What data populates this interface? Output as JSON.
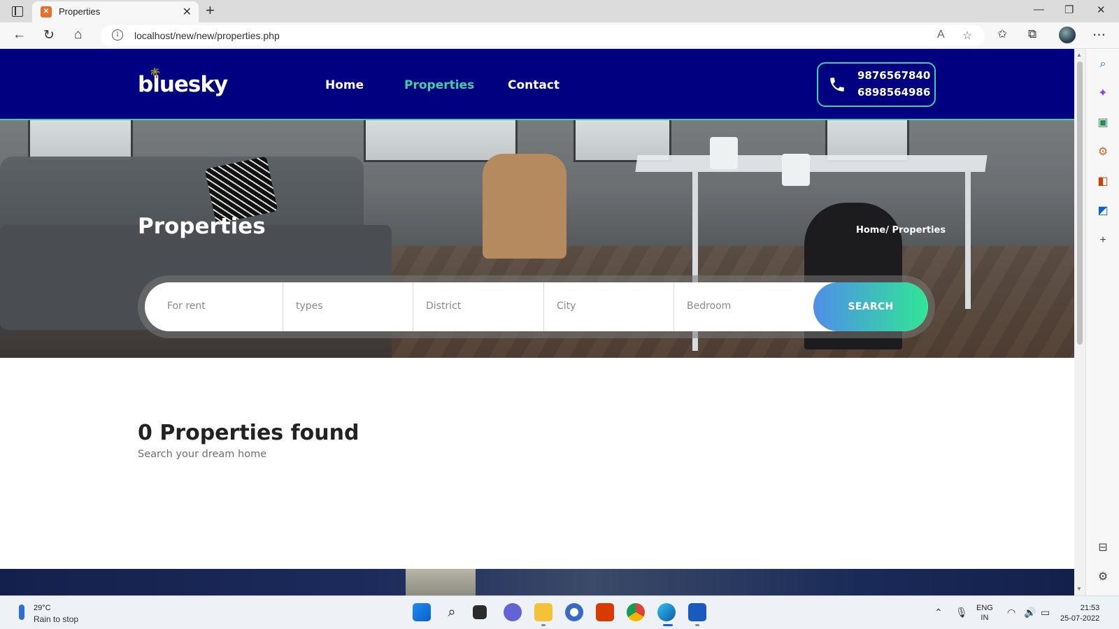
{
  "browser": {
    "tab_title": "Properties",
    "url": "localhost/new/new/properties.php"
  },
  "site": {
    "logo": "bluesky",
    "nav": [
      {
        "label": "Home",
        "active": false
      },
      {
        "label": "Properties",
        "active": true
      },
      {
        "label": "Contact",
        "active": false
      }
    ],
    "phones": [
      "9876567840",
      "6898564986"
    ],
    "accent_color": "#3ad2a0",
    "header_color": "#000080"
  },
  "hero": {
    "title": "Properties",
    "breadcrumb": {
      "home": "Home",
      "separator": "/",
      "current": "Properties"
    }
  },
  "search": {
    "fields": [
      "For rent",
      "types",
      "District",
      "City",
      "Bedroom"
    ],
    "button_label": "SEARCH"
  },
  "results": {
    "title": "0 Properties found",
    "subtitle": "Search your dream home"
  },
  "taskbar": {
    "weather_temp": "29°C",
    "weather_desc": "Rain to stop",
    "lang_top": "ENG",
    "lang_bottom": "IN",
    "time": "21:53",
    "date": "25-07-2022"
  }
}
